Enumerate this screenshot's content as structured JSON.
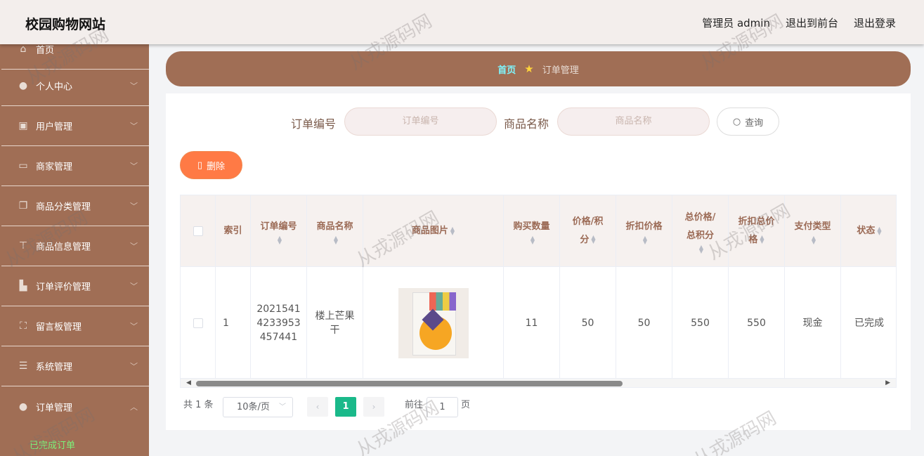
{
  "header": {
    "title": "校园购物网站",
    "admin_label": "管理员 admin",
    "front_label": "退出到前台",
    "logout_label": "退出登录"
  },
  "sidebar": {
    "items": [
      {
        "label": "首页",
        "icon": "home-icon"
      },
      {
        "label": "个人中心",
        "icon": "user-icon"
      },
      {
        "label": "用户管理",
        "icon": "clipboard-icon"
      },
      {
        "label": "商家管理",
        "icon": "chat-icon"
      },
      {
        "label": "商品分类管理",
        "icon": "copy-icon"
      },
      {
        "label": "商品信息管理",
        "icon": "pin-icon"
      },
      {
        "label": "订单评价管理",
        "icon": "thumb-icon"
      },
      {
        "label": "留言板管理",
        "icon": "frame-icon"
      },
      {
        "label": "系统管理",
        "icon": "list-icon"
      },
      {
        "label": "订单管理",
        "icon": "bulb-icon"
      }
    ],
    "sub_item": "已完成订单",
    "sub_color": "#7cf27a"
  },
  "breadcrumb": {
    "home": "首页",
    "current": "订单管理"
  },
  "search": {
    "order_no_label": "订单编号",
    "order_no_placeholder": "订单编号",
    "product_label": "商品名称",
    "product_placeholder": "商品名称",
    "query_button": "查询"
  },
  "delete_button": "删除",
  "table": {
    "headers": {
      "index": "索引",
      "order_no": "订单编号",
      "product_name": "商品名称",
      "product_image": "商品图片",
      "quantity": "购买数量",
      "price_a": "价格/积",
      "price_b": "分",
      "discount_price": "折扣价格",
      "total_a": "总价格/",
      "total_b": "总积分",
      "discount_total_a": "折扣总价",
      "discount_total_b": "格",
      "pay_type": "支付类型",
      "status": "状态"
    },
    "row": {
      "index": "1",
      "order_no_lines": [
        "2021541",
        "4233953",
        "457441"
      ],
      "product_name_lines": [
        "楼上芒果",
        "干"
      ],
      "quantity": "11",
      "price": "50",
      "discount_price": "50",
      "total": "550",
      "discount_total": "550",
      "pay_type": "现金",
      "status": "已完成"
    }
  },
  "pagination": {
    "total": "共 1 条",
    "page_size": "10条/页",
    "current_page": "1",
    "goto_label": "前往",
    "goto_value": "1",
    "page_suffix": "页"
  },
  "watermark": "从戎源码网",
  "colors": {
    "sidebar": "#a06e55",
    "accent": "#1ab98a",
    "delete": "#ff7a45"
  }
}
